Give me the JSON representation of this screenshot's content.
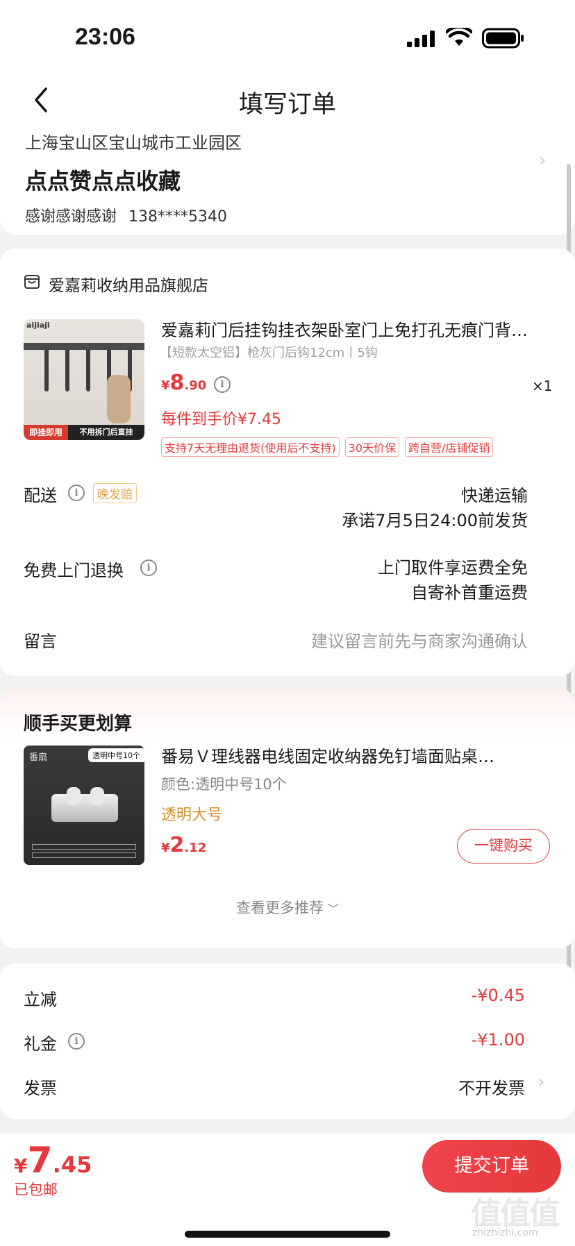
{
  "status_bar": {
    "time": "23:06"
  },
  "header": {
    "title": "填写订单"
  },
  "address": {
    "region": "上海宝山区宝山城市工业园区",
    "detail": "点点赞点点收藏",
    "recipient": "感谢感谢感谢",
    "phone": "138****5340"
  },
  "store": {
    "name": "爱嘉莉收纳用品旗舰店",
    "product": {
      "title": "爱嘉莉门后挂钩挂衣架卧室门上免打孔无痕门背…",
      "spec": "【短款太空铝】枪灰门后钩12cm丨5钩",
      "price_symbol": "¥",
      "price_int": "8",
      "price_dec": ".90",
      "qty": "×1",
      "final_price": "每件到手价¥7.45",
      "image_brand": "aijiaji",
      "image_badge_left": "即挂即用",
      "image_badge_right": "不用拆门后直挂",
      "tags": [
        "支持7天无理由退货(使用后不支持)",
        "30天价保",
        "跨自营/店铺促销"
      ]
    },
    "delivery": {
      "label": "配送",
      "badge": "晚发赔",
      "method": "快递运输",
      "promise": "承诺7月5日24:00前发货"
    },
    "return": {
      "label": "免费上门退换",
      "line1": "上门取件享运费全免",
      "line2": "自寄补首重运费"
    },
    "message": {
      "label": "留言",
      "placeholder": "建议留言前先与商家沟通确认"
    }
  },
  "recommend": {
    "title": "顺手买更划算",
    "item": {
      "title": "番易Ｖ理线器电线固定收纳器免钉墙面贴桌…",
      "color": "颜色:透明中号10个",
      "variant": "透明大号",
      "price_symbol": "¥",
      "price_int": "2",
      "price_dec": ".12",
      "buy_label": "一键购买",
      "image_brand": "番扇",
      "image_tag": "透明中号10个"
    },
    "more_label": "查看更多推荐"
  },
  "summary": {
    "discount_label": "立减",
    "discount_value": "-¥0.45",
    "gift_label": "礼金",
    "gift_value": "-¥1.00",
    "invoice_label": "发票",
    "invoice_value": "不开发票"
  },
  "footer": {
    "total_symbol": "¥",
    "total_int": "7",
    "total_dec": ".45",
    "shipping": "已包邮",
    "submit_label": "提交订单",
    "watermark": "值值值",
    "watermark_url": "zhizhizhi.com"
  },
  "colors": {
    "accent": "#e4393c",
    "orange": "#e0a040"
  }
}
